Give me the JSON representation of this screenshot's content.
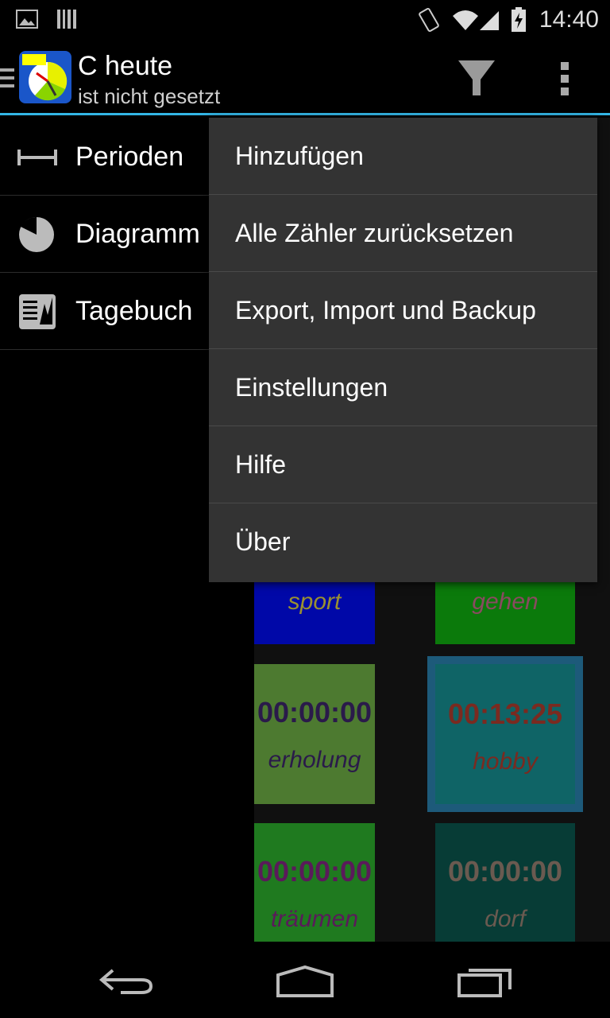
{
  "status_bar": {
    "time": "14:40"
  },
  "action_bar": {
    "title": "C heute",
    "subtitle": "ist nicht gesetzt"
  },
  "drawer": {
    "items": [
      {
        "label": "Perioden"
      },
      {
        "label": "Diagramm"
      },
      {
        "label": "Tagebuch"
      }
    ]
  },
  "menu": {
    "items": [
      {
        "label": "Hinzufügen"
      },
      {
        "label": "Alle Zähler zurücksetzen"
      },
      {
        "label": "Export, Import und Backup"
      },
      {
        "label": "Einstellungen"
      },
      {
        "label": "Hilfe"
      },
      {
        "label": "Über"
      }
    ]
  },
  "tiles": [
    {
      "time": "",
      "name": "sport",
      "bg": "#0008a8"
    },
    {
      "time": "",
      "name": "gehen",
      "bg": "#0b7a0b"
    },
    {
      "time": "00:00:00",
      "name": "erholung",
      "bg": "#4d7a30"
    },
    {
      "time": "00:13:25",
      "name": "hobby",
      "bg": "#0f6466"
    },
    {
      "time": "00:00:00",
      "name": "träumen",
      "bg": "#1f7a1f"
    },
    {
      "time": "00:00:00",
      "name": "dorf",
      "bg": "#073c36"
    }
  ],
  "colors": {
    "accent": "#33b5e5",
    "menu_bg": "#333333"
  }
}
